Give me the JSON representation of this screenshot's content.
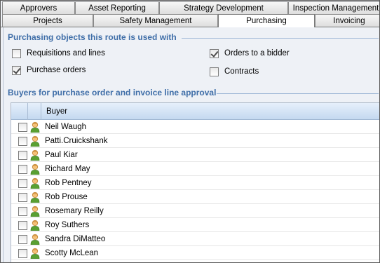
{
  "tabs_row1": [
    {
      "label": "Approvers"
    },
    {
      "label": "Asset Reporting"
    },
    {
      "label": "Strategy Development"
    },
    {
      "label": "Inspection Management"
    }
  ],
  "tabs_row2": [
    {
      "label": "Projects"
    },
    {
      "label": "Safety Management"
    },
    {
      "label": "Purchasing"
    },
    {
      "label": "Invoicing"
    }
  ],
  "active_tab": "Purchasing",
  "objects_section": {
    "title": "Purchasing objects this route is used with",
    "options": [
      {
        "label": "Requisitions and lines",
        "checked": false
      },
      {
        "label": "Purchase orders",
        "checked": true
      },
      {
        "label": "Orders to a bidder",
        "checked": true
      },
      {
        "label": "Contracts",
        "checked": false
      }
    ]
  },
  "buyers_section": {
    "title": "Buyers for purchase order and invoice line approval",
    "column_header": "Buyer",
    "buyers": [
      "Neil Waugh",
      "Patti.Cruickshank",
      "Paul Kiar",
      "Richard May",
      "Rob Pentney",
      "Rob Prouse",
      "Rosemary Reilly",
      "Roy Suthers",
      "Sandra DiMatteo",
      "Scotty McLean"
    ]
  },
  "colors": {
    "section_title": "#3f6ea8",
    "background": "#eef1f6",
    "header_gradient_top": "#e6f0fb",
    "header_gradient_bottom": "#c4d9f0"
  }
}
